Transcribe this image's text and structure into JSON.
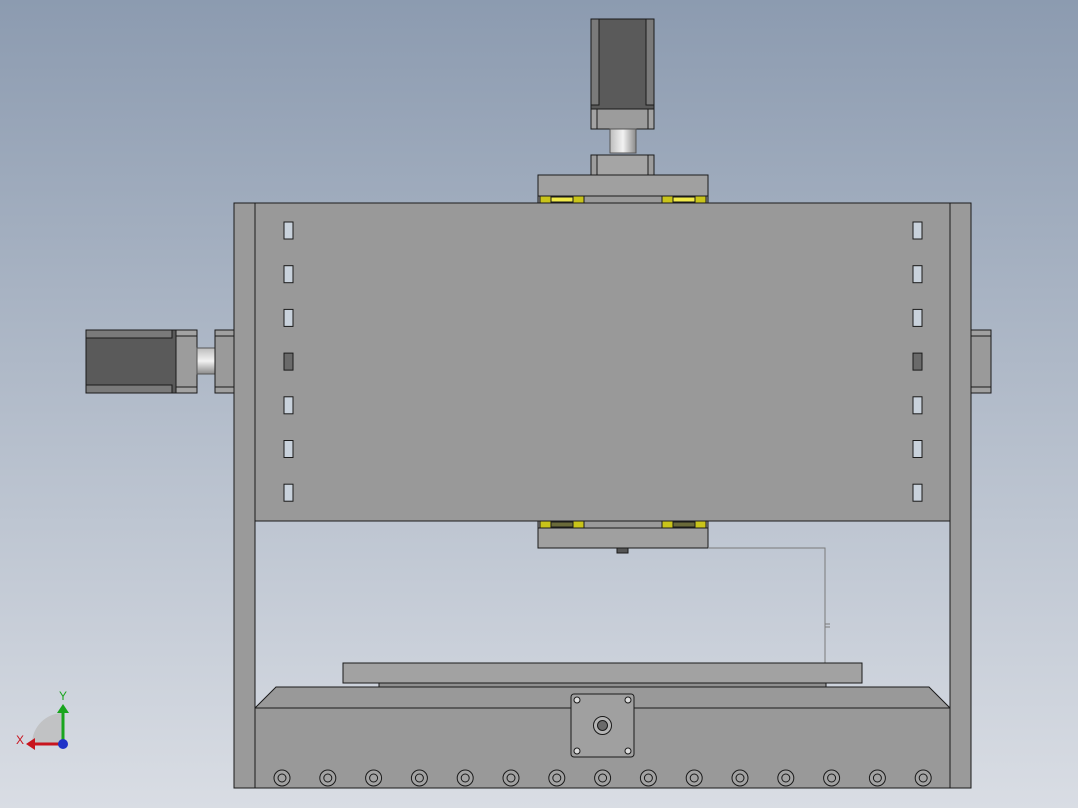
{
  "viewport": {
    "background_top": "#8c9bb0",
    "background_bottom": "#d9dde4"
  },
  "model": {
    "frame_color": "#9a9a9a",
    "panel_color": "#999999",
    "motor_dark": "#595959",
    "motor_light": "#9f9f9f",
    "bearing_color": "#d4cf1e",
    "bolt_count": 15,
    "slot_rows": 7
  },
  "triad": {
    "x_label": "X",
    "y_label": "Y",
    "x_color": "#c8141e",
    "y_color": "#19a51e",
    "z_color": "#1e32c8"
  }
}
